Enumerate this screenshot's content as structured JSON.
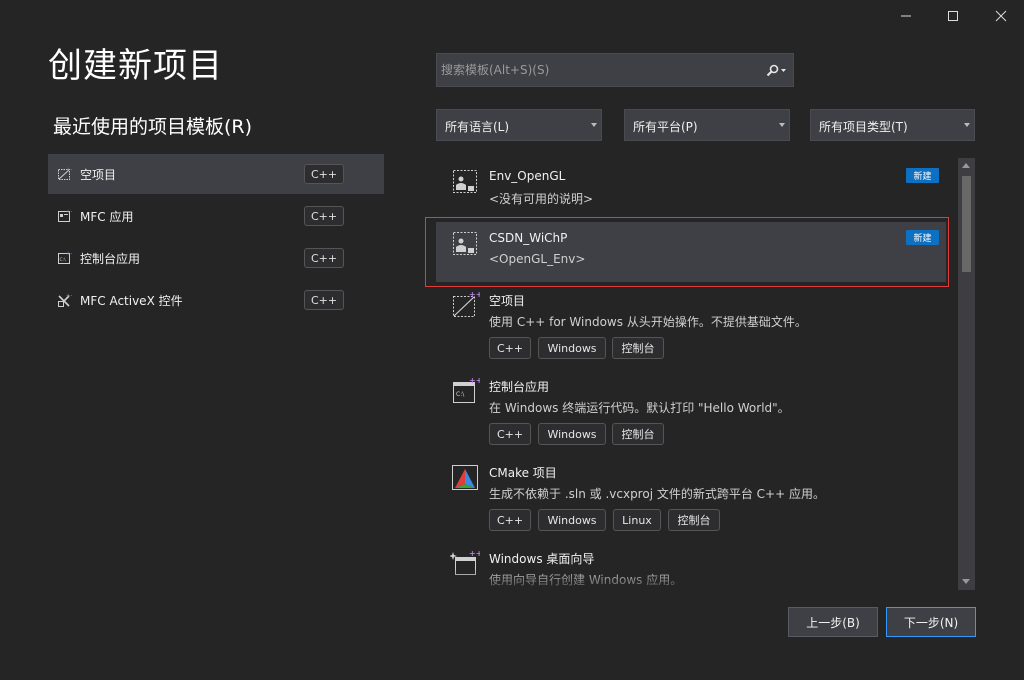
{
  "window": {
    "minimize_icon": "minimize-icon",
    "maximize_icon": "maximize-icon",
    "close_icon": "close-icon"
  },
  "title": "创建新项目",
  "recent": {
    "heading": "最近使用的项目模板(R)",
    "items": [
      {
        "label": "空项目",
        "lang": "C++",
        "icon": "empty-project-icon",
        "selected": true
      },
      {
        "label": "MFC 应用",
        "lang": "C++",
        "icon": "mfc-app-icon"
      },
      {
        "label": "控制台应用",
        "lang": "C++",
        "icon": "console-app-icon"
      },
      {
        "label": "MFC ActiveX 控件",
        "lang": "C++",
        "icon": "activex-icon"
      }
    ]
  },
  "search": {
    "placeholder": "搜索模板(Alt+S)(S)",
    "icon": "search-icon"
  },
  "filters": {
    "language": "所有语言(L)",
    "platform": "所有平台(P)",
    "project_type": "所有项目类型(T)"
  },
  "templates": [
    {
      "name": "Env_OpenGL",
      "desc": "<没有可用的说明>",
      "badge": "新建",
      "icon": "custom-template-icon"
    },
    {
      "name": "CSDN_WiChP",
      "desc": "<OpenGL_Env>",
      "badge": "新建",
      "icon": "custom-template-icon",
      "selected": true,
      "highlight_color": "#e03c3c"
    },
    {
      "name": "空项目",
      "desc": "使用 C++ for Windows 从头开始操作。不提供基础文件。",
      "tags": [
        "C++",
        "Windows",
        "控制台"
      ],
      "icon": "empty-project-icon"
    },
    {
      "name": "控制台应用",
      "desc": "在 Windows 终端运行代码。默认打印 \"Hello World\"。",
      "tags": [
        "C++",
        "Windows",
        "控制台"
      ],
      "icon": "console-app-icon"
    },
    {
      "name": "CMake 项目",
      "desc": "生成不依赖于 .sln 或 .vcxproj 文件的新式跨平台 C++ 应用。",
      "tags": [
        "C++",
        "Windows",
        "Linux",
        "控制台"
      ],
      "icon": "cmake-icon"
    },
    {
      "name": "Windows 桌面向导",
      "desc": "使用向导自行创建 Windows 应用。",
      "icon": "desktop-wizard-icon"
    }
  ],
  "buttons": {
    "back": "上一步(B)",
    "next": "下一步(N)"
  },
  "colors": {
    "background": "#252526",
    "accent": "#3399ff",
    "badge": "#0e70c0"
  }
}
